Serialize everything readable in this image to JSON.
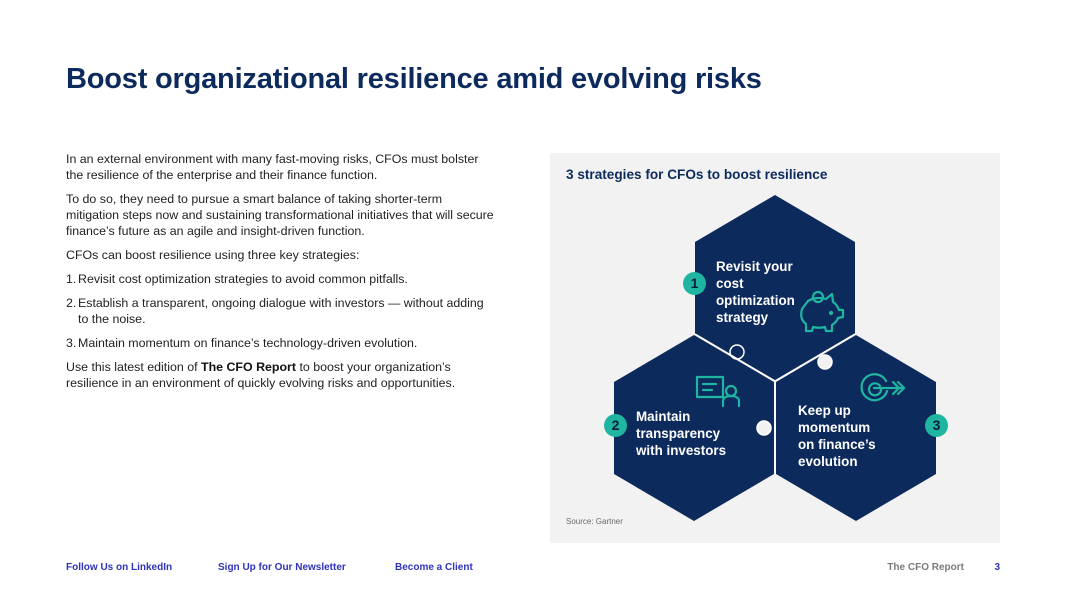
{
  "page": {
    "title": "Boost organizational resilience amid evolving risks"
  },
  "intro": {
    "p1": "In an external environment with many fast-moving risks, CFOs must bolster the resilience of the enterprise and their finance function.",
    "p2": "To do so, they need to pursue a smart balance of taking shorter-term mitigation steps now and sustaining transformational initiatives that will secure finance’s future as an agile and insight-driven function.",
    "p3": "CFOs can boost resilience using three key strategies:",
    "list": [
      {
        "num": "1.",
        "text": "Revisit cost optimization strategies to avoid common pitfalls."
      },
      {
        "num": "2.",
        "text": "Establish a transparent, ongoing dialogue with investors — without adding to the noise."
      },
      {
        "num": "3.",
        "text": "Maintain momentum on finance’s technology-driven evolution."
      }
    ],
    "closing_pre": "Use this latest edition of ",
    "closing_bold": "The CFO Report",
    "closing_post": " to boost your organization’s resilience in an environment of quickly evolving risks and opportunities."
  },
  "figure": {
    "title": "3 strategies for CFOs to boost resilience",
    "source": "Source: Gartner",
    "colors": {
      "panel": "#f2f2f2",
      "hex": "#0d2a5c",
      "accent": "#1fb5a0"
    },
    "strategies": [
      {
        "num": "1",
        "text": "Revisit your cost optimization strategy",
        "icon": "piggy-bank-icon"
      },
      {
        "num": "2",
        "text": "Maintain transparency with investors",
        "icon": "presenter-icon"
      },
      {
        "num": "3",
        "text": "Keep up momentum on finance’s evolution",
        "icon": "target-icon"
      }
    ]
  },
  "footer": {
    "linkedin": "Follow Us on LinkedIn",
    "newsletter": "Sign Up for Our Newsletter",
    "client": "Become a Client",
    "report": "The CFO Report",
    "page_number": "3"
  }
}
